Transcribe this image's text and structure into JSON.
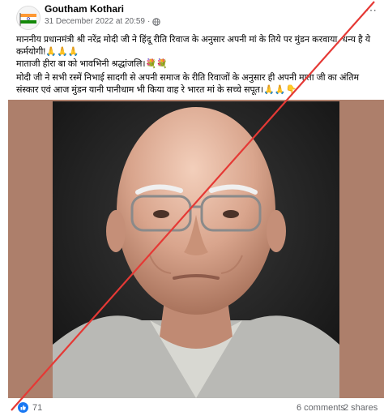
{
  "post": {
    "author": "Goutham Kothari",
    "date": "31 December 2022 at 20:59",
    "audience_icon": "globe-icon",
    "more_icon": "more-options-icon",
    "paragraphs": [
      "माननीय प्रधानमंत्री श्री नरेंद्र मोदी जी ने हिंदू रीति रिवाज के अनुसार अपनी मां के तिये पर मुंडन करवाया, धन्य है ये कर्मयोगी!🙏🙏🙏",
      "माताजी हीरा बा को भावभिनी श्रद्धांजलि।💐💐",
      "मोदी जी ने सभी रस्में निभाई सादगी से अपनी समाज के रीति रिवाजों के अनुसार ही अपनी माता जी का अंतिम संस्कार एवं आज मुंडन यानी पानीधाम भी किया वाह रे भारत मां के सच्चे सपूत।🙏🙏👇"
    ]
  },
  "reactions": {
    "icon": "like-icon",
    "count": "71",
    "comments": "6 comments",
    "shares": "2 shares"
  },
  "overlay": {
    "mark": "red-cross-mark",
    "color": "#e53935"
  }
}
